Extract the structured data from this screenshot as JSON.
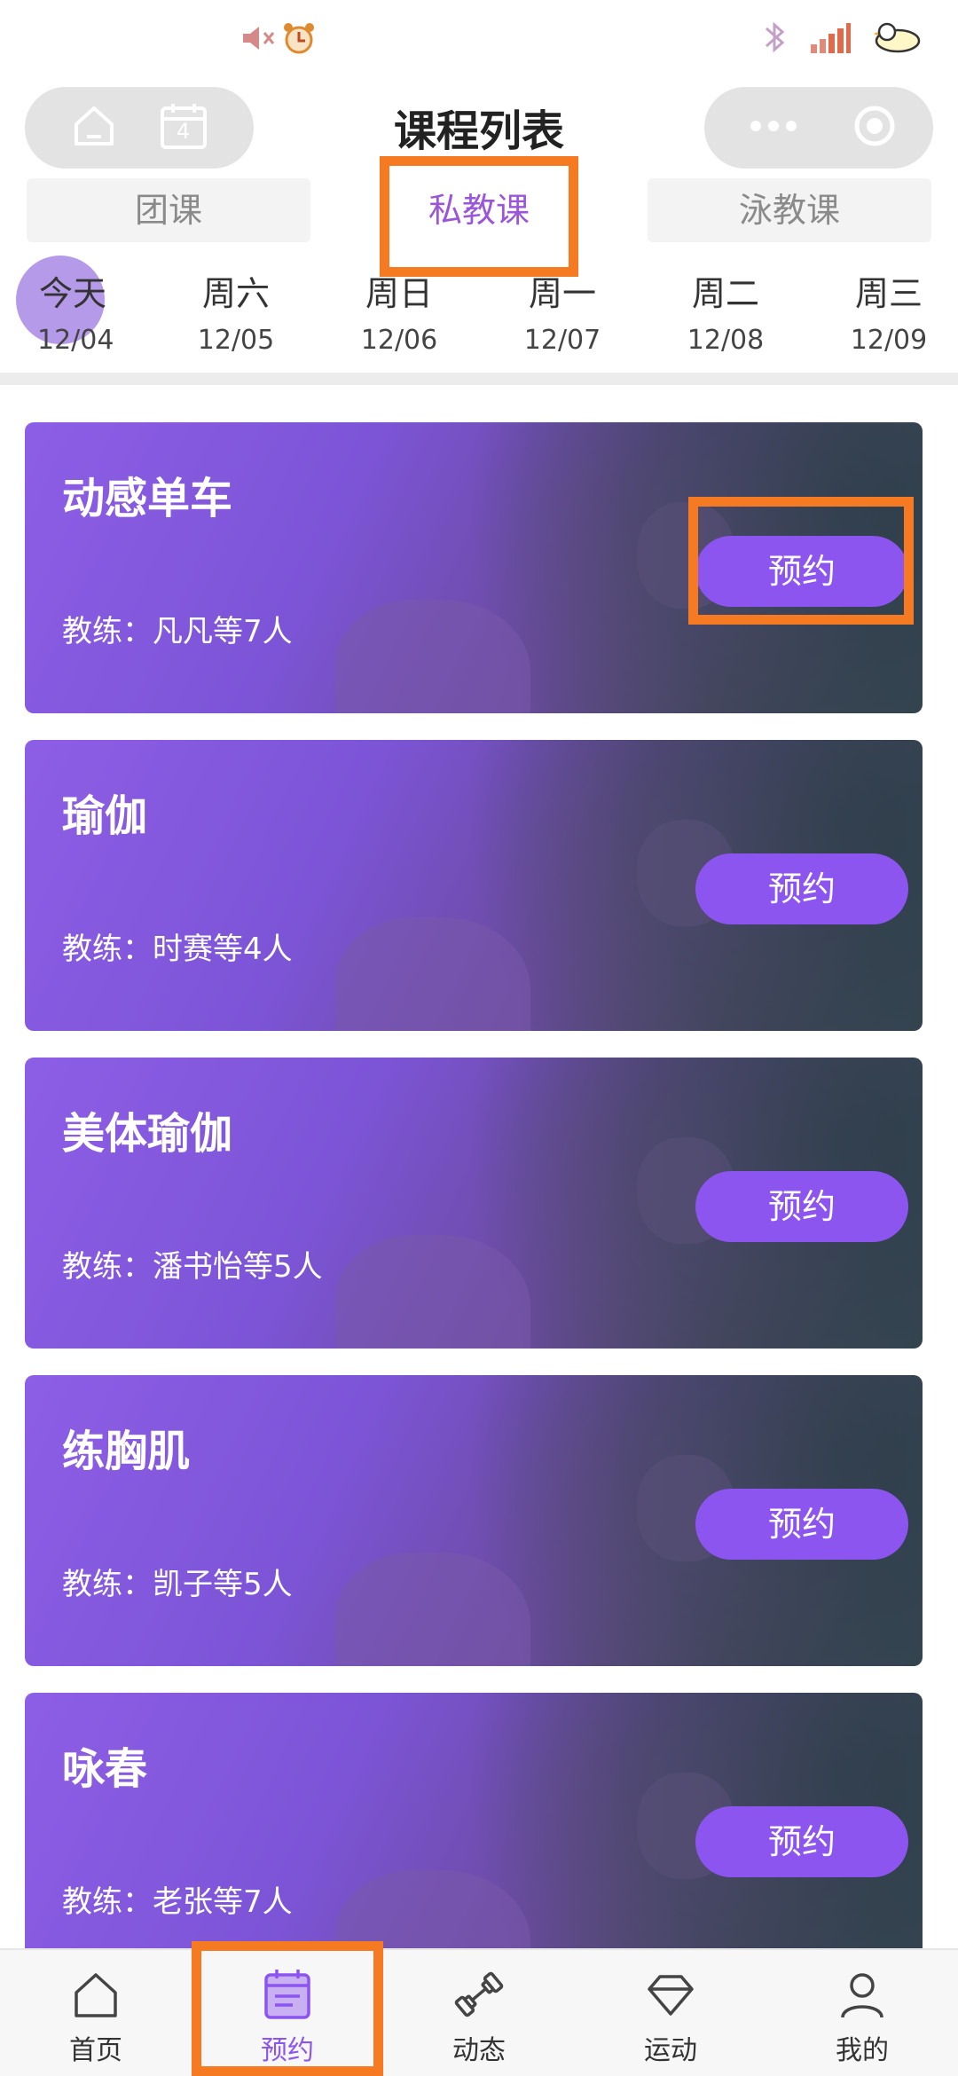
{
  "colors": {
    "accent": "#8c55f0",
    "highlight": "#f57a22",
    "active_tab": "#9a55d8"
  },
  "status_bar": {
    "center_icons": [
      "mute-icon",
      "alarm-icon"
    ],
    "right_icons": [
      "bluetooth-icon",
      "signal-icon",
      "battery-icon"
    ]
  },
  "header": {
    "title": "课程列表",
    "left_capsule": {
      "icons": [
        "home-icon",
        "calendar-icon"
      ],
      "calendar_day": "4"
    },
    "right_capsule": {
      "icons": [
        "more-icon",
        "close-target-icon"
      ]
    }
  },
  "tabs": [
    {
      "label": "团课",
      "active": false
    },
    {
      "label": "私教课",
      "active": true
    },
    {
      "label": "泳教课",
      "active": false
    }
  ],
  "dates": [
    {
      "weekday": "今天",
      "date": "12/04",
      "active": true
    },
    {
      "weekday": "周六",
      "date": "12/05",
      "active": false
    },
    {
      "weekday": "周日",
      "date": "12/06",
      "active": false
    },
    {
      "weekday": "周一",
      "date": "12/07",
      "active": false
    },
    {
      "weekday": "周二",
      "date": "12/08",
      "active": false
    },
    {
      "weekday": "周三",
      "date": "12/09",
      "active": false
    }
  ],
  "courses": [
    {
      "name": "动感单车",
      "coach": "教练：凡凡等7人",
      "button": "预约"
    },
    {
      "name": "瑜伽",
      "coach": "教练：时赛等4人",
      "button": "预约"
    },
    {
      "name": "美体瑜伽",
      "coach": "教练：潘书怡等5人",
      "button": "预约"
    },
    {
      "name": "练胸肌",
      "coach": "教练：凯子等5人",
      "button": "预约"
    },
    {
      "name": "咏春",
      "coach": "教练：老张等7人",
      "button": "预约"
    }
  ],
  "bottom_nav": [
    {
      "label": "首页",
      "icon": "home-icon",
      "active": false
    },
    {
      "label": "预约",
      "icon": "calendar-icon",
      "active": true
    },
    {
      "label": "动态",
      "icon": "dumbbell-icon",
      "active": false
    },
    {
      "label": "运动",
      "icon": "diamond-icon",
      "active": false
    },
    {
      "label": "我的",
      "icon": "profile-icon",
      "active": false
    }
  ]
}
